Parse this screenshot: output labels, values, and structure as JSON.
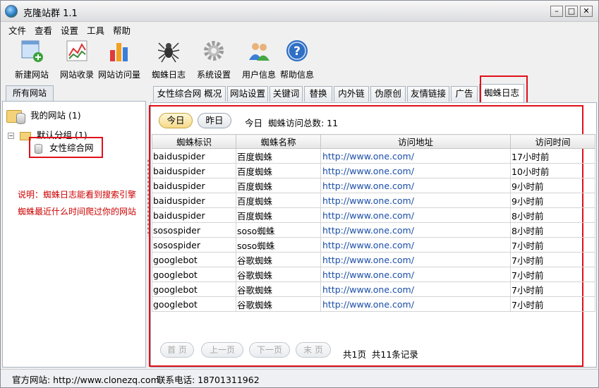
{
  "app": {
    "title": "克隆站群 1.1"
  },
  "menu": [
    "文件",
    "查看",
    "设置",
    "工具",
    "帮助"
  ],
  "toolbar": [
    {
      "label": "新建网站",
      "icon": "new-site-icon"
    },
    {
      "label": "网站收录",
      "icon": "site-index-icon"
    },
    {
      "label": "网站访问量",
      "icon": "site-traffic-icon"
    },
    {
      "label": "蜘蛛日志",
      "icon": "spider-icon"
    },
    {
      "label": "系统设置",
      "icon": "gear-icon"
    },
    {
      "label": "用户信息",
      "icon": "users-icon"
    },
    {
      "label": "帮助信息",
      "icon": "help-icon"
    }
  ],
  "sidebar": {
    "tab_label": "所有网站",
    "root": "我的网站 (1)",
    "group": "默认分组 (1)",
    "site": "女性综合网",
    "note_line1": "说明：蜘蛛日志能看到搜索引擎",
    "note_line2": "蜘蛛最近什么时间爬过你的网站"
  },
  "tabs": [
    "女性综合网 概况",
    "网站设置",
    "关键词",
    "替换",
    "内外链",
    "伪原创",
    "友情链接",
    "广告",
    "蜘蛛日志"
  ],
  "filters": {
    "today": "今日",
    "yesterday": "昨日",
    "summary_prefix": "今日",
    "summary_label": "蜘蛛访问总数:",
    "summary_count": "11"
  },
  "table": {
    "columns": [
      "蜘蛛标识",
      "蜘蛛名称",
      "访问地址",
      "访问时间"
    ],
    "rows": [
      [
        "baiduspider",
        "百度蜘蛛",
        "http://www.one.com/",
        "17小时前"
      ],
      [
        "baiduspider",
        "百度蜘蛛",
        "http://www.one.com/",
        "10小时前"
      ],
      [
        "baiduspider",
        "百度蜘蛛",
        "http://www.one.com/",
        "9小时前"
      ],
      [
        "baiduspider",
        "百度蜘蛛",
        "http://www.one.com/",
        "9小时前"
      ],
      [
        "baiduspider",
        "百度蜘蛛",
        "http://www.one.com/",
        "8小时前"
      ],
      [
        "sosospider",
        "soso蜘蛛",
        "http://www.one.com/",
        "8小时前"
      ],
      [
        "sosospider",
        "soso蜘蛛",
        "http://www.one.com/",
        "7小时前"
      ],
      [
        "googlebot",
        "谷歌蜘蛛",
        "http://www.one.com/",
        "7小时前"
      ],
      [
        "googlebot",
        "谷歌蜘蛛",
        "http://www.one.com/",
        "7小时前"
      ],
      [
        "googlebot",
        "谷歌蜘蛛",
        "http://www.one.com/",
        "7小时前"
      ],
      [
        "googlebot",
        "谷歌蜘蛛",
        "http://www.one.com/",
        "7小时前"
      ]
    ]
  },
  "pager": {
    "first": "首 页",
    "prev": "上一页",
    "next": "下一页",
    "last": "末 页",
    "summary": "共1页  共11条记录"
  },
  "status": {
    "website": "官方网站: http://www.clonezq.com",
    "phone": "联系电话: 18701311962"
  },
  "colors": {
    "annotation": "#e0101a",
    "note_text": "#cc0000",
    "link": "#1a4ea8"
  }
}
